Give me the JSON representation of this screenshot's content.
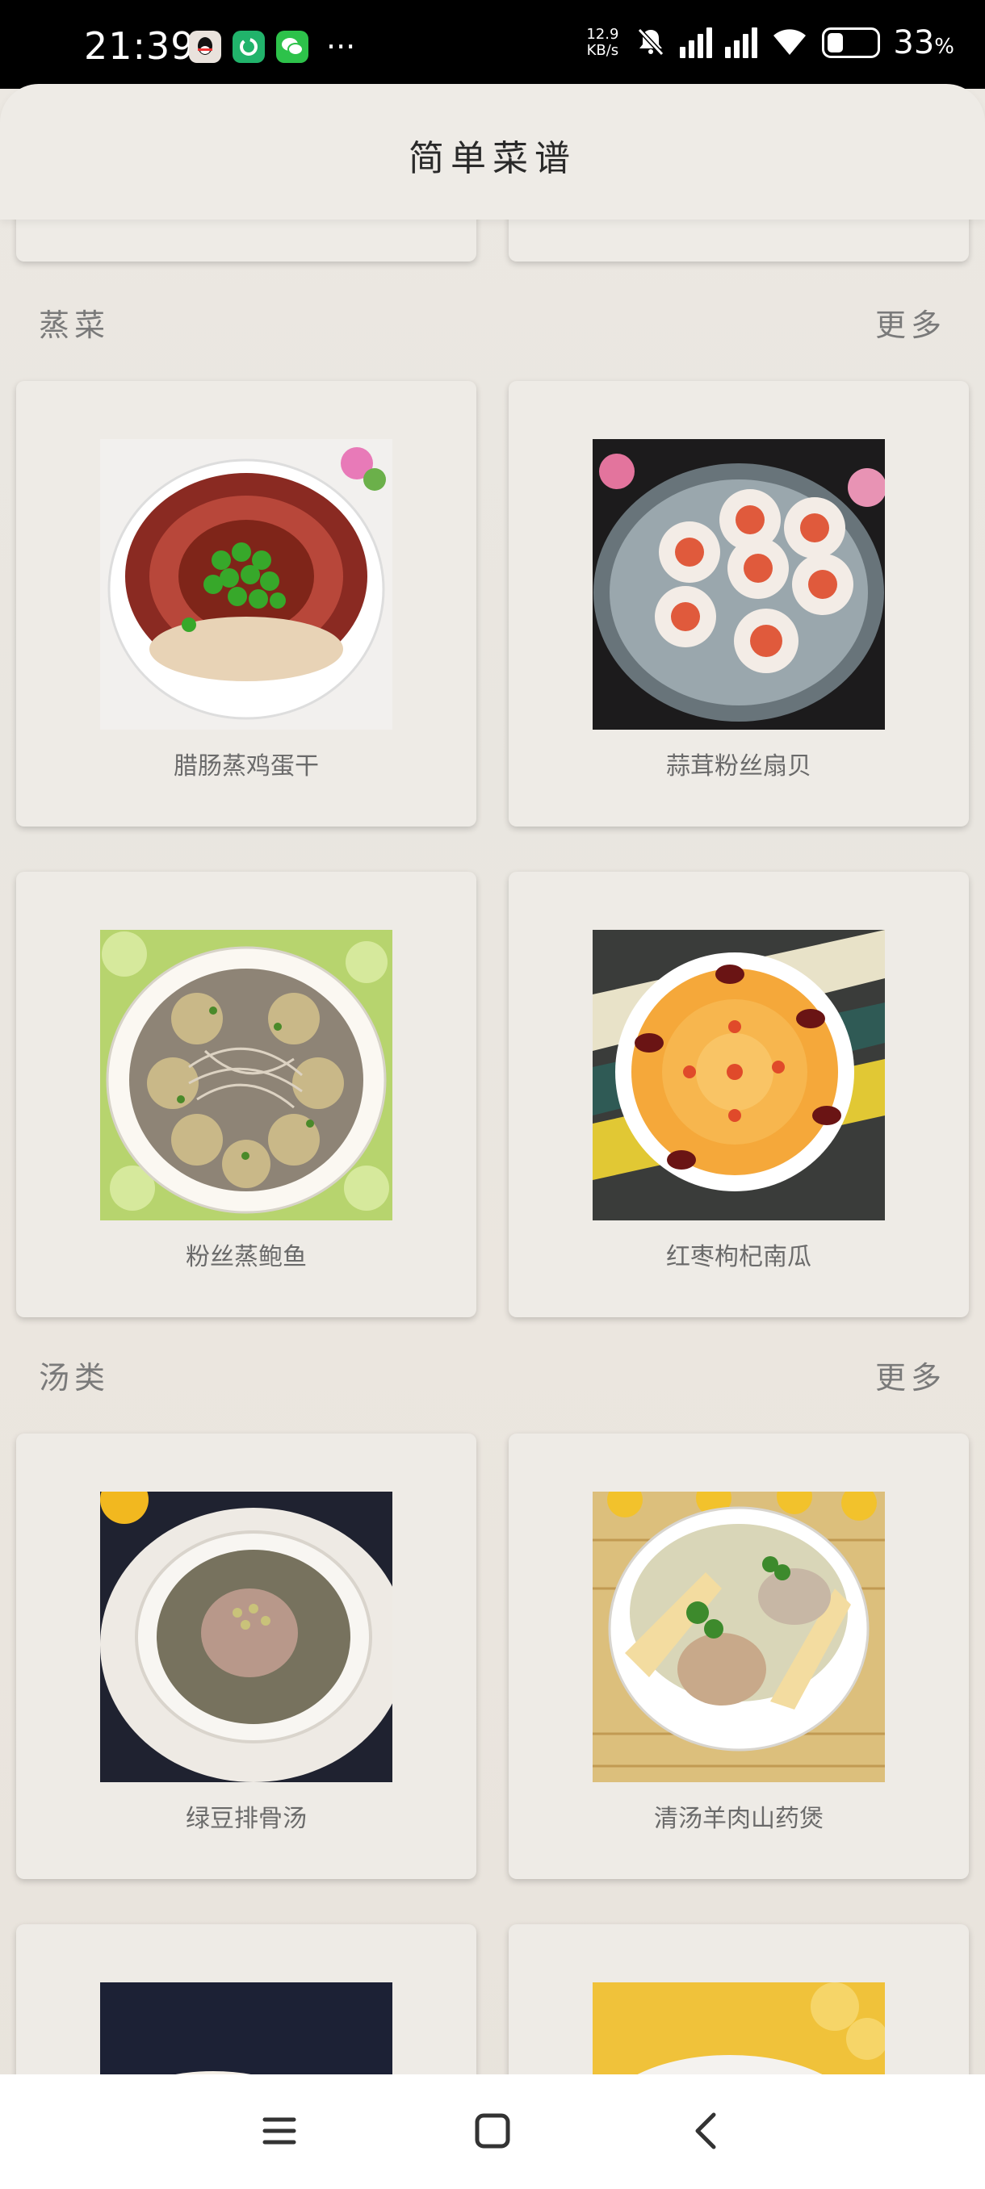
{
  "status": {
    "time": "21:39",
    "netspeed_value": "12.9",
    "netspeed_unit": "KB/s",
    "battery": "33",
    "battery_unit": "%",
    "battery_level": 0.33,
    "more_dots": "···"
  },
  "header": {
    "title": "简单菜谱"
  },
  "sections": [
    {
      "name": "蒸菜",
      "more": "更多",
      "items": [
        {
          "label": "腊肠蒸鸡蛋干"
        },
        {
          "label": "蒜茸粉丝扇贝"
        },
        {
          "label": "粉丝蒸鲍鱼"
        },
        {
          "label": "红枣枸杞南瓜"
        }
      ]
    },
    {
      "name": "汤类",
      "more": "更多",
      "items": [
        {
          "label": "绿豆排骨汤"
        },
        {
          "label": "清汤羊肉山药煲"
        }
      ]
    }
  ],
  "icons": {
    "status_bar": [
      "qq-icon",
      "recycle-app-icon",
      "wechat-icon",
      "mute-icon",
      "signal-icon",
      "wifi-icon",
      "battery-icon"
    ],
    "nav_bar": [
      "menu-icon",
      "home-icon",
      "back-icon"
    ]
  },
  "colors": {
    "background": "#ebe7e1",
    "card": "#eeebe6",
    "section_text": "#7a7a7a",
    "caption_text": "#6a6a6a"
  }
}
